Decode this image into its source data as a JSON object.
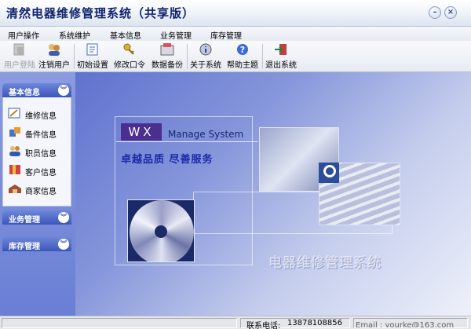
{
  "window": {
    "title": "清然电器维修管理系统（共享版）",
    "minimize_glyph": "–",
    "close_glyph": "×"
  },
  "menu": [
    "用户操作",
    "系统维护",
    "基本信息",
    "业务管理",
    "库存管理"
  ],
  "toolbar": {
    "login": "用户登陆",
    "logout": "注销用户",
    "init": "初始设置",
    "change_password": "修改口令",
    "backup": "数据备份",
    "about": "关于系统",
    "help": "帮助主题",
    "exit": "退出系统"
  },
  "sidebar": {
    "groups": [
      {
        "title": "基本信息",
        "items": [
          "维修信息",
          "备件信息",
          "职员信息",
          "客户信息",
          "商家信息"
        ]
      },
      {
        "title": "业务管理"
      },
      {
        "title": "库存管理"
      }
    ],
    "chevron_glyph": "︾"
  },
  "splash": {
    "brand_box": "WX",
    "brand_text": "Manage System",
    "slogan": "卓越品质  尽善服务",
    "watermark": "电器维修管理系统"
  },
  "status": {
    "phone_label": "联系电话:",
    "phone_value": "13878108856",
    "email_fragment": "Email : yourke@163.com"
  },
  "colors": {
    "title_text": "#10246e",
    "sidebar_header": "#3b56b8",
    "brand_box": "#4b2f8e",
    "slogan": "#1a2aa8"
  }
}
